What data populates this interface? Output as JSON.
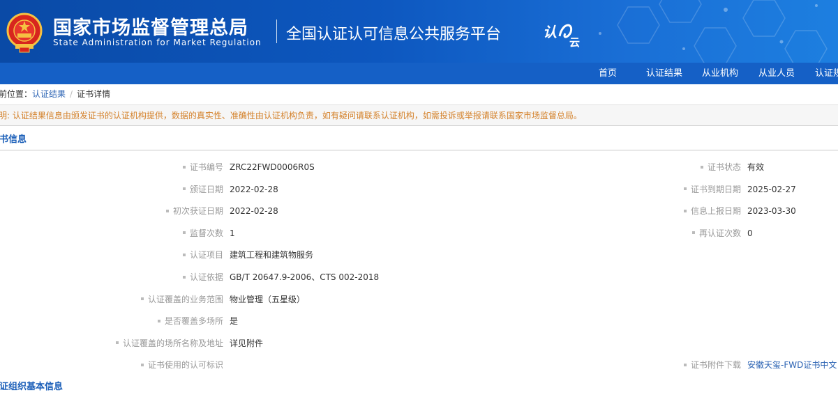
{
  "header": {
    "title_cn": "国家市场监督管理总局",
    "title_en": "State Administration for Market Regulation",
    "platform_title": "全国认证认可信息公共服务平台",
    "platform_logo_text": "认云"
  },
  "nav": {
    "items": [
      "首页",
      "认证结果",
      "从业机构",
      "从业人员",
      "认证规"
    ]
  },
  "breadcrumb": {
    "prefix": "当前位置：",
    "link": "认证结果",
    "separator": "/",
    "current": "证书详情"
  },
  "notice": "声明: 认证结果信息由颁发证书的认证机构提供，数据的真实性、准确性由认证机构负责，如有疑问请联系认证机构，如需投诉或举报请联系国家市场监督总局。",
  "section_certificate": "证书信息",
  "section_org": "获证组织基本信息",
  "left_fields": [
    {
      "label": "证书编号",
      "value": "ZRC22FWD0006R0S"
    },
    {
      "label": "颁证日期",
      "value": "2022-02-28"
    },
    {
      "label": "初次获证日期",
      "value": "2022-02-28"
    },
    {
      "label": "监督次数",
      "value": "1"
    },
    {
      "label": "认证项目",
      "value": "建筑工程和建筑物服务"
    },
    {
      "label": "认证依据",
      "value": "GB/T 20647.9-2006、CTS 002-2018"
    },
    {
      "label": "认证覆盖的业务范围",
      "value": "物业管理（五星级）"
    },
    {
      "label": "是否覆盖多场所",
      "value": "是"
    },
    {
      "label": "认证覆盖的场所名称及地址",
      "value": "详见附件"
    },
    {
      "label": "证书使用的认可标识",
      "value": ""
    }
  ],
  "right_fields": [
    {
      "label": "证书状态",
      "value": "有效"
    },
    {
      "label": "证书到期日期",
      "value": "2025-02-27"
    },
    {
      "label": "信息上报日期",
      "value": "2023-03-30"
    },
    {
      "label": "再认证次数",
      "value": "0"
    },
    {
      "label": "证书附件下载",
      "value": "安徽天玺-FWD证书中文"
    }
  ]
}
